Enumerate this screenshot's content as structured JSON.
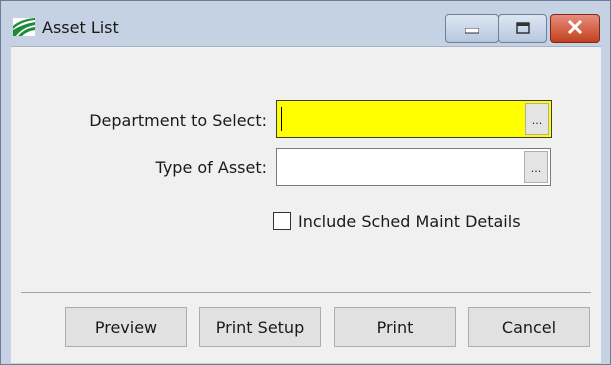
{
  "window": {
    "title": "Asset List",
    "controls": {
      "minimize": "minimize",
      "maximize": "maximize",
      "close": "close"
    }
  },
  "form": {
    "department_label": "Department to Select:",
    "department_value": "",
    "department_browse": "...",
    "type_label": "Type of Asset:",
    "type_value": "",
    "type_browse": "...",
    "include_sched_label": "Include Sched Maint Details",
    "include_sched_checked": false
  },
  "buttons": {
    "preview": "Preview",
    "print_setup": "Print Setup",
    "print": "Print",
    "cancel": "Cancel"
  },
  "colors": {
    "active_field": "#ffff00",
    "client_bg": "#f0f0f0",
    "frame": "#c5d2e3",
    "close_button": "#c94a2b"
  },
  "icons": {
    "app": "app-logo-icon",
    "minimize": "minimize-icon",
    "maximize": "maximize-icon",
    "close": "close-icon"
  }
}
